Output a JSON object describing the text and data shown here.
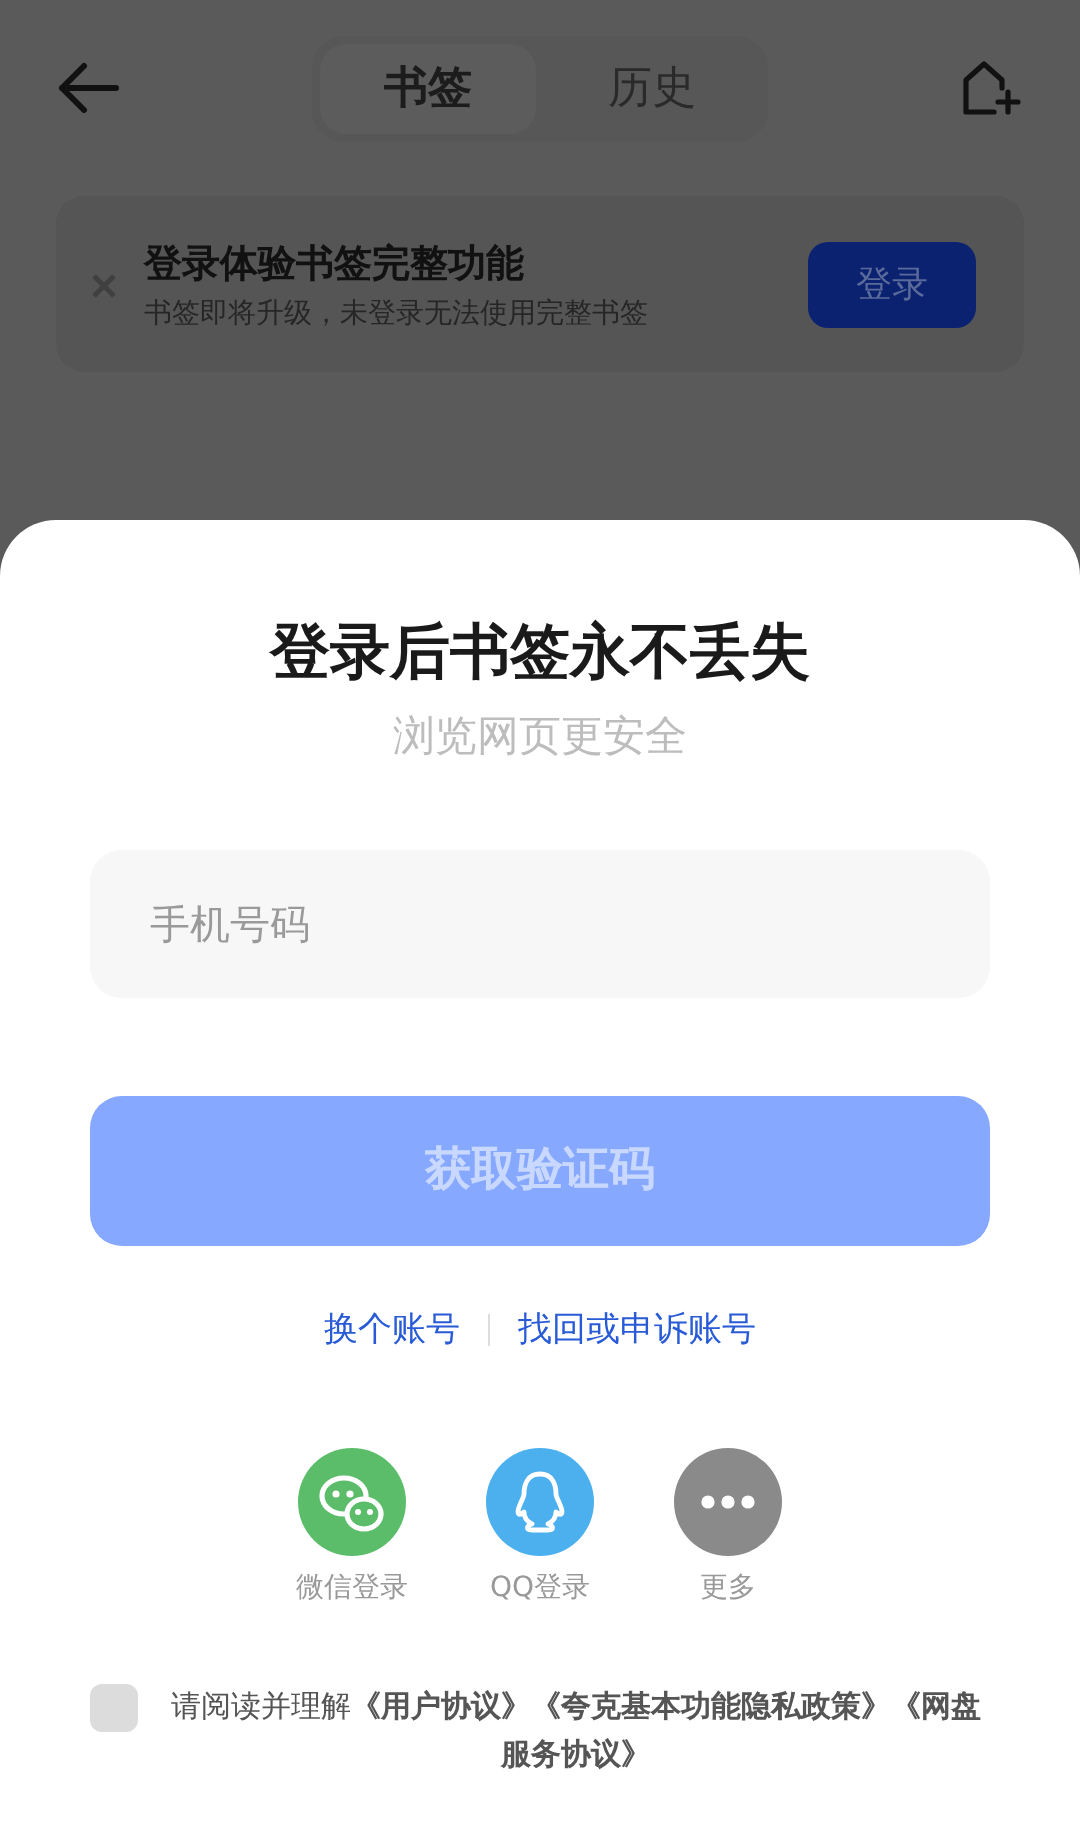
{
  "header": {
    "tabs": [
      {
        "label": "书签",
        "selected": true
      },
      {
        "label": "历史",
        "selected": false
      }
    ]
  },
  "banner": {
    "title": "登录体验书签完整功能",
    "subtitle": "书签即将升级，未登录无法使用完整书签",
    "button": "登录"
  },
  "sheet": {
    "title": "登录后书签永不丢失",
    "subtitle": "浏览网页更安全",
    "phone_field": {
      "placeholder": "手机号码"
    },
    "submit": {
      "label": "获取验证码",
      "disabled": true
    },
    "links": [
      "换个账号",
      "找回或申诉账号"
    ],
    "social": [
      {
        "kind": "wechat",
        "label": "微信登录"
      },
      {
        "kind": "qq",
        "label": "QQ登录"
      },
      {
        "kind": "more",
        "label": "更多"
      }
    ],
    "agreement": {
      "checked": false,
      "text": "请阅读并理解**《用户协议》《夸克基本功能隐私政策》《网盘服务协议》**"
    }
  }
}
